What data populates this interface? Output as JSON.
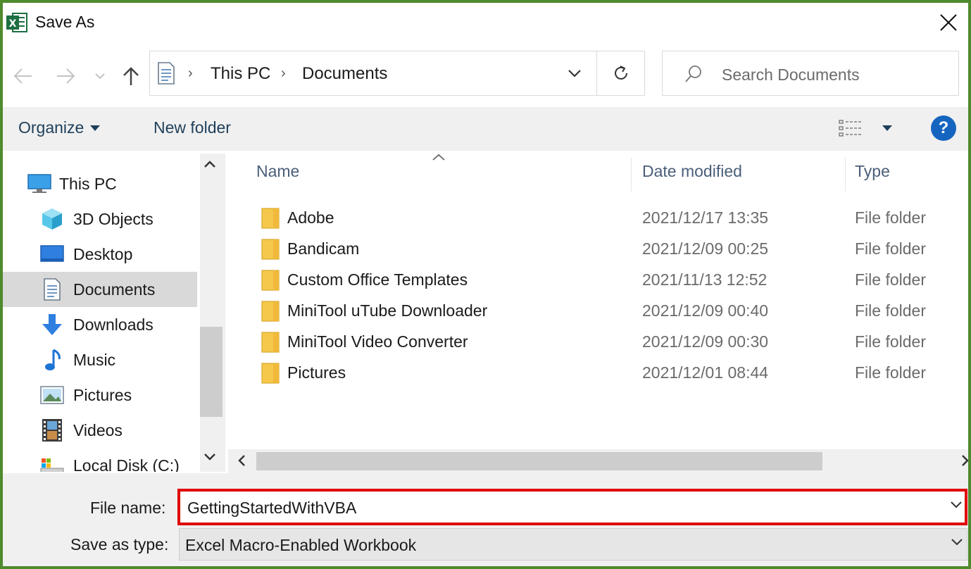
{
  "window": {
    "title": "Save As",
    "app_icon": "excel-icon",
    "close_icon": "close-icon"
  },
  "navigation": {
    "back_icon": "back-arrow-icon",
    "forward_icon": "forward-arrow-icon",
    "recent_icon": "chevron-down-icon",
    "up_icon": "up-arrow-icon"
  },
  "address_bar": {
    "location_icon": "documents-icon",
    "breadcrumbs": [
      "This PC",
      "Documents"
    ],
    "dropdown_icon": "chevron-down-icon",
    "refresh_icon": "refresh-icon"
  },
  "search": {
    "placeholder": "Search Documents",
    "icon": "search-icon"
  },
  "toolbar": {
    "organize_label": "Organize",
    "new_folder_label": "New folder",
    "view_icon": "details-view-icon",
    "help_label": "?"
  },
  "sidebar": {
    "items": [
      {
        "label": "This PC",
        "icon": "computer-icon"
      },
      {
        "label": "3D Objects",
        "icon": "3d-objects-icon"
      },
      {
        "label": "Desktop",
        "icon": "desktop-icon"
      },
      {
        "label": "Documents",
        "icon": "documents-icon",
        "selected": true
      },
      {
        "label": "Downloads",
        "icon": "download-icon"
      },
      {
        "label": "Music",
        "icon": "music-icon"
      },
      {
        "label": "Pictures",
        "icon": "pictures-icon"
      },
      {
        "label": "Videos",
        "icon": "videos-icon"
      },
      {
        "label": "Local Disk (C:)",
        "icon": "drive-icon"
      }
    ]
  },
  "file_list": {
    "columns": [
      "Name",
      "Date modified",
      "Type"
    ],
    "rows": [
      {
        "name": "Adobe",
        "date": "2021/12/17 13:35",
        "type": "File folder"
      },
      {
        "name": "Bandicam",
        "date": "2021/12/09 00:25",
        "type": "File folder"
      },
      {
        "name": "Custom Office Templates",
        "date": "2021/11/13 12:52",
        "type": "File folder"
      },
      {
        "name": "MiniTool uTube Downloader",
        "date": "2021/12/09 00:40",
        "type": "File folder"
      },
      {
        "name": "MiniTool Video Converter",
        "date": "2021/12/09 00:30",
        "type": "File folder"
      },
      {
        "name": "Pictures",
        "date": "2021/12/01 08:44",
        "type": "File folder"
      }
    ]
  },
  "form": {
    "file_name_label": "File name:",
    "file_name_value": "GettingStartedWithVBA",
    "save_type_label": "Save as type:",
    "save_type_value": "Excel Macro-Enabled Workbook"
  },
  "colors": {
    "frame_border": "#4f8a2c",
    "highlight_border": "#e00000",
    "help_blue": "#1565c0",
    "folder_yellow": "#f5c84c"
  }
}
